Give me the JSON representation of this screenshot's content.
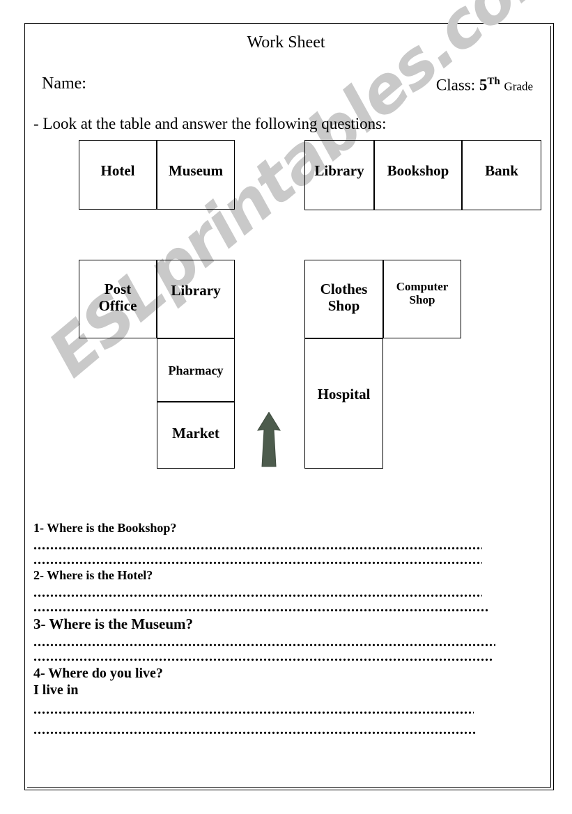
{
  "document": {
    "title": "Work Sheet",
    "name_label": "Name:",
    "class_prefix": "Class:",
    "class_number": "5",
    "class_ordinal": "Th",
    "class_suffix": "Grade",
    "instruction": "- Look at the table and answer the following questions:"
  },
  "watermark": {
    "text": "ESLprintables.com",
    "color": "#c9c9c9"
  },
  "arrow": {
    "name": "up-arrow",
    "color": "#4a5a4a"
  },
  "tables": {
    "top_left": {
      "cells": [
        {
          "label": "Hotel"
        },
        {
          "label": "Museum"
        }
      ]
    },
    "top_right": {
      "cells": [
        {
          "label": "Library"
        },
        {
          "label": "Bookshop"
        },
        {
          "label": "Bank"
        }
      ]
    },
    "bottom_left": {
      "cells": [
        {
          "label_line1": "Post",
          "label_line2": "Office"
        },
        {
          "label": "Library"
        },
        {
          "label": "Pharmacy"
        },
        {
          "label": "Market"
        }
      ]
    },
    "bottom_right": {
      "cells": [
        {
          "label_line1": "Clothes",
          "label_line2": "Shop"
        },
        {
          "label_line1": "Computer",
          "label_line2": "Shop"
        },
        {
          "label": "Hospital"
        }
      ]
    }
  },
  "questions": [
    {
      "number": "1",
      "text": "- Where is the Bookshop?"
    },
    {
      "number": "2",
      "text": "- Where is the Hotel?"
    },
    {
      "number": "3",
      "text": "- Where is the Museum?"
    },
    {
      "number": "4",
      "text": "- Where do you live?"
    }
  ],
  "q4_answer_prompt": "I live in",
  "answer_lines": {
    "dots": "......................................................................................................................................................"
  }
}
